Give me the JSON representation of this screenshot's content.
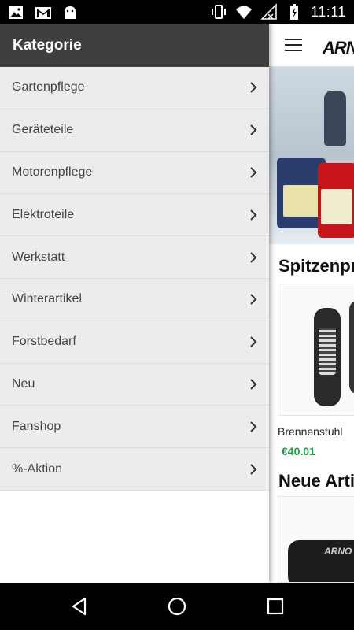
{
  "status_bar": {
    "time": "11:11",
    "left_icons": [
      "image-icon",
      "gmail-icon",
      "android-icon"
    ],
    "right_icons": [
      "vibrate-icon",
      "wifi-icon",
      "no-signal-icon",
      "battery-charging-icon"
    ]
  },
  "drawer": {
    "title": "Kategorie",
    "items": [
      {
        "label": "Gartenpflege"
      },
      {
        "label": "Geräteteile"
      },
      {
        "label": "Motorenpflege"
      },
      {
        "label": "Elektroteile"
      },
      {
        "label": "Werkstatt"
      },
      {
        "label": "Winterartikel"
      },
      {
        "label": "Forstbedarf"
      },
      {
        "label": "Neu"
      },
      {
        "label": "Fanshop"
      },
      {
        "label": "%-Aktion"
      }
    ]
  },
  "app": {
    "brand": "ARN",
    "section_top_title": "Spitzenpr",
    "product": {
      "name": "Brennenstuhl",
      "price": "€40.01"
    },
    "section_new_title": "Neue Arti",
    "case_brand": "ARNO"
  },
  "nav_bar": {
    "buttons": [
      "back-icon",
      "home-icon",
      "recents-icon"
    ]
  },
  "colors": {
    "drawer_header": "#3f3f3f",
    "drawer_item_bg": "#ececec",
    "price_green": "#1f9d4a",
    "status_bar": "#000000"
  }
}
